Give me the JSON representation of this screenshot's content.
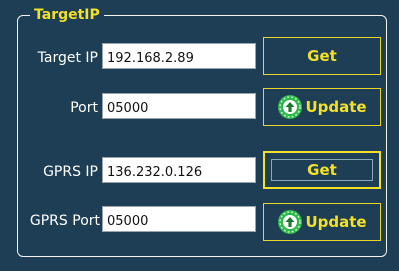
{
  "group": {
    "title": "TargetIP"
  },
  "target": {
    "ip_label": "Target IP",
    "ip_value": "192.168.2.89",
    "port_label": "Port",
    "port_value": "05000",
    "get_label": "Get",
    "update_label": "Update"
  },
  "gprs": {
    "ip_label": "GPRS IP",
    "ip_value": "136.232.0.126",
    "port_label": "GPRS Port",
    "port_value": "05000",
    "get_label": "Get",
    "update_label": "Update"
  },
  "colors": {
    "background": "#1d3e54",
    "accent": "#f2e02a",
    "icon_green": "#2fb84a"
  },
  "icons": {
    "update": "upload-arrow-circle-icon"
  }
}
